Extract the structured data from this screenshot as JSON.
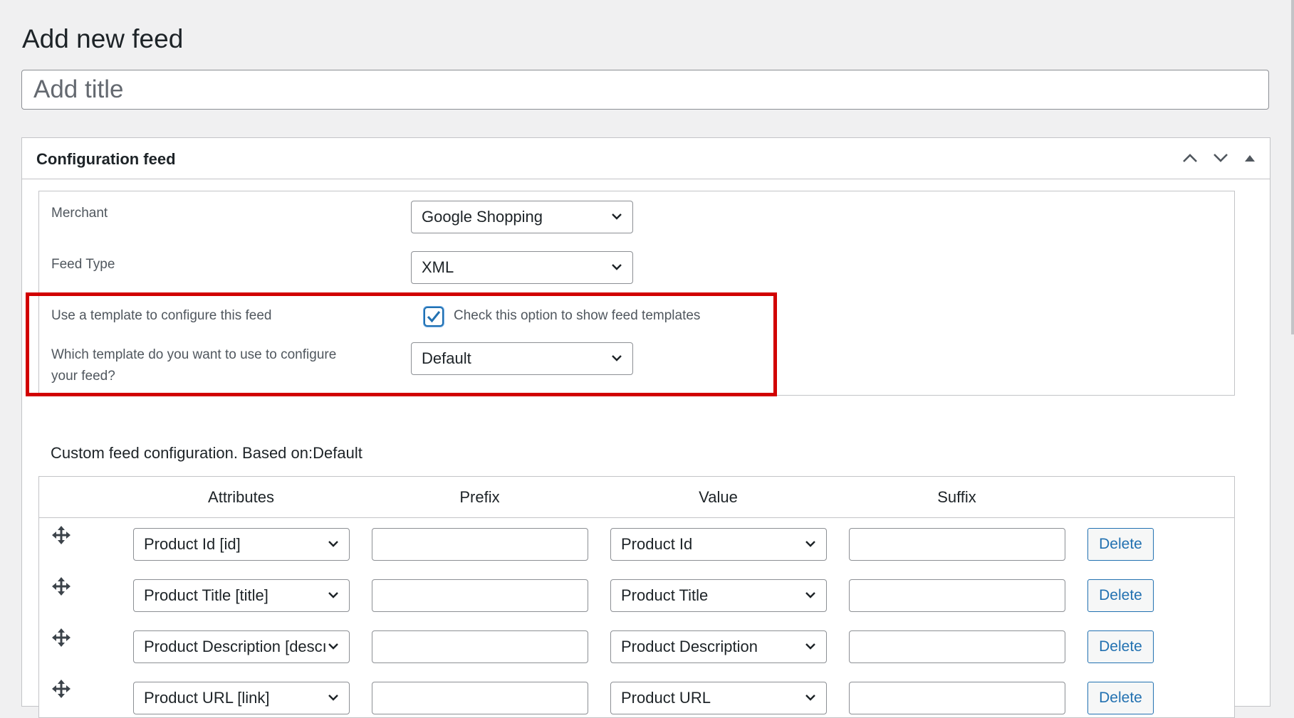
{
  "page": {
    "title": "Add new feed",
    "title_placeholder": "Add title"
  },
  "config_panel": {
    "title": "Configuration feed",
    "merchant": {
      "label": "Merchant",
      "value": "Google Shopping"
    },
    "feed_type": {
      "label": "Feed Type",
      "value": "XML"
    },
    "use_template": {
      "label": "Use a template to configure this feed",
      "checkbox_label": "Check this option to show feed templates",
      "checked": true
    },
    "which_template": {
      "label_line1": "Which template do you want to use to configure",
      "label_line2": "your feed?",
      "value": "Default"
    }
  },
  "custom_config": {
    "title": "Custom feed configuration. Based on:Default",
    "columns": [
      "Attributes",
      "Prefix",
      "Value",
      "Suffix"
    ],
    "delete_label": "Delete",
    "rows": [
      {
        "attribute": "Product Id [id]",
        "prefix": "",
        "value": "Product Id",
        "suffix": ""
      },
      {
        "attribute": "Product Title [title]",
        "prefix": "",
        "value": "Product Title",
        "suffix": ""
      },
      {
        "attribute": "Product Description [descı",
        "prefix": "",
        "value": "Product Description",
        "suffix": ""
      },
      {
        "attribute": "Product URL [link]",
        "prefix": "",
        "value": "Product URL",
        "suffix": ""
      }
    ]
  },
  "colors": {
    "highlight": "#d10000",
    "accent": "#2271b1"
  }
}
